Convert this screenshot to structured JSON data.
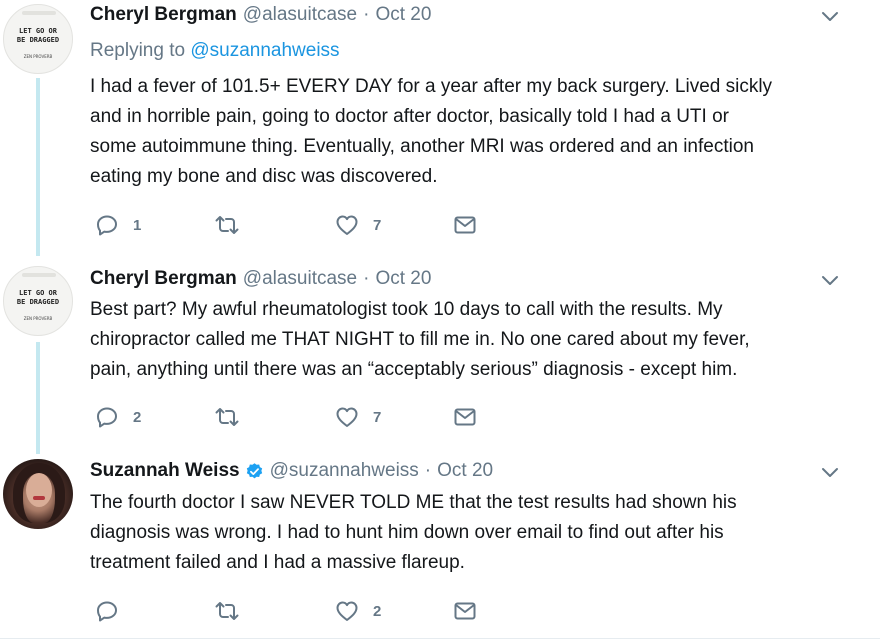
{
  "tweets": [
    {
      "name": "Cheryl Bergman",
      "handle": "@alasuitcase",
      "separator": "·",
      "date": "Oct 20",
      "verified": false,
      "reply_prefix": "Replying to",
      "reply_handle": "@suzannahweiss",
      "avatar_lines": [
        "LET GO OR",
        "BE DRAGGED"
      ],
      "avatar_sub": "ZEN PROVERB",
      "text_lines": [
        "I had a fever of 101.5+ EVERY DAY for a year after my back surgery. Lived sickly",
        "and in horrible pain, going to doctor after doctor, basically told I had a UTI or",
        "some autoimmune thing. Eventually, another MRI was ordered and an infection",
        "eating my bone and disc was discovered."
      ],
      "replies": "1",
      "retweets": "",
      "likes": "7"
    },
    {
      "name": "Cheryl Bergman",
      "handle": "@alasuitcase",
      "separator": "·",
      "date": "Oct 20",
      "verified": false,
      "avatar_lines": [
        "LET GO OR",
        "BE DRAGGED"
      ],
      "avatar_sub": "ZEN PROVERB",
      "text_lines": [
        "Best part? My awful rheumatologist took 10 days to call with the results. My",
        "chiropractor called me THAT NIGHT to fill me in. No one cared about my fever,",
        "pain, anything until there was an “acceptably serious” diagnosis - except him."
      ],
      "replies": "2",
      "retweets": "",
      "likes": "7"
    },
    {
      "name": "Suzannah Weiss",
      "handle": "@suzannahweiss",
      "separator": "·",
      "date": "Oct 20",
      "verified": true,
      "text_lines": [
        "The fourth doctor I saw NEVER TOLD ME that the test results had shown his",
        "diagnosis was wrong. I had to hunt him down over email to find out after his",
        "treatment failed and I had a massive flareup."
      ],
      "replies": "",
      "retweets": "",
      "likes": "2"
    }
  ],
  "icons": {
    "reply": "reply-icon",
    "retweet": "retweet-icon",
    "like": "heart-icon",
    "dm": "envelope-icon",
    "caret": "chevron-down-icon",
    "verified": "verified-badge-icon"
  },
  "colors": {
    "link": "#1b95e0",
    "muted": "#657786",
    "text": "#14171a",
    "thread_line": "#c4e8f0",
    "verified": "#1da1f2"
  }
}
